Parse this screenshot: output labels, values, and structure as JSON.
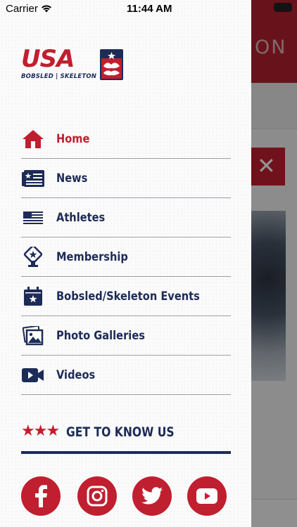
{
  "status_bar": {
    "carrier": "Carrier",
    "time": "11:44 AM"
  },
  "background": {
    "header_text": "ON",
    "close_glyph": "✕"
  },
  "logo": {
    "primary": "USA",
    "secondary": "BOBSLED | SKELETON"
  },
  "nav": {
    "items": [
      {
        "label": "Home",
        "icon": "house-icon",
        "active": true
      },
      {
        "label": "News",
        "icon": "newspaper-icon"
      },
      {
        "label": "Athletes",
        "icon": "flag-icon"
      },
      {
        "label": "Membership",
        "icon": "membership-badge-icon"
      },
      {
        "label": "Bobsled/Skeleton Events",
        "icon": "calendar-star-icon"
      },
      {
        "label": "Photo Galleries",
        "icon": "photo-gallery-icon"
      },
      {
        "label": "Videos",
        "icon": "video-camera-icon"
      }
    ]
  },
  "get_to_know": {
    "stars": "★★★",
    "label": "GET TO KNOW US"
  },
  "socials": [
    {
      "icon": "facebook-icon"
    },
    {
      "icon": "instagram-icon"
    },
    {
      "icon": "twitter-icon"
    },
    {
      "icon": "youtube-icon"
    }
  ],
  "colors": {
    "brand_red": "#c01f2f",
    "navy": "#1d2b57",
    "divider": "#9aa0a8"
  }
}
